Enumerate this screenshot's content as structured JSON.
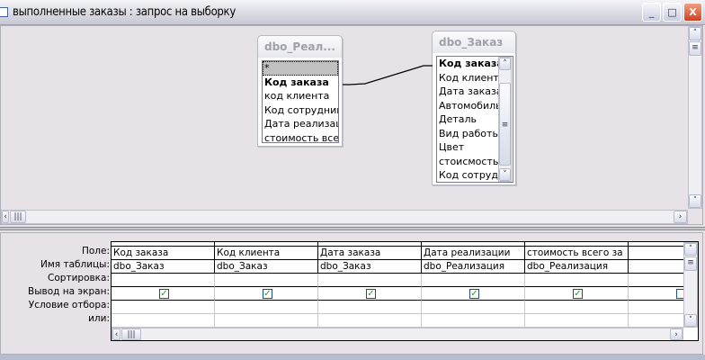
{
  "window": {
    "title": "выполненные заказы : запрос на выборку",
    "minimize": "_",
    "maximize": "□",
    "close": "X"
  },
  "tables": [
    {
      "title": "dbo_Реал...",
      "fields": [
        "*",
        "Код заказа",
        "код клиента",
        "Код сотрудника",
        "Дата реализаци",
        "стоимость всего"
      ]
    },
    {
      "title": "dbo_Заказ",
      "fields": [
        "Код заказа",
        "Код клиента",
        "Дата заказа",
        "Автомобиль",
        "Деталь",
        "Вид работы",
        "Цвет",
        "стоисмость",
        "Код сотрудн"
      ]
    }
  ],
  "grid": {
    "row_labels": [
      "Поле:",
      "Имя таблицы:",
      "Сортировка:",
      "Вывод на экран:",
      "Условие отбора:",
      "или:"
    ],
    "columns": [
      {
        "field": "Код заказа",
        "table": "dbo_Заказ",
        "show": true
      },
      {
        "field": "Код клиента",
        "table": "dbo_Заказ",
        "show": true
      },
      {
        "field": "Дата заказа",
        "table": "dbo_Заказ",
        "show": true
      },
      {
        "field": "Дата реализации",
        "table": "dbo_Реализация",
        "show": true
      },
      {
        "field": "стоимость всего за",
        "table": "dbo_Реализация",
        "show": true
      },
      {
        "field": "",
        "table": "",
        "show": false
      }
    ]
  }
}
